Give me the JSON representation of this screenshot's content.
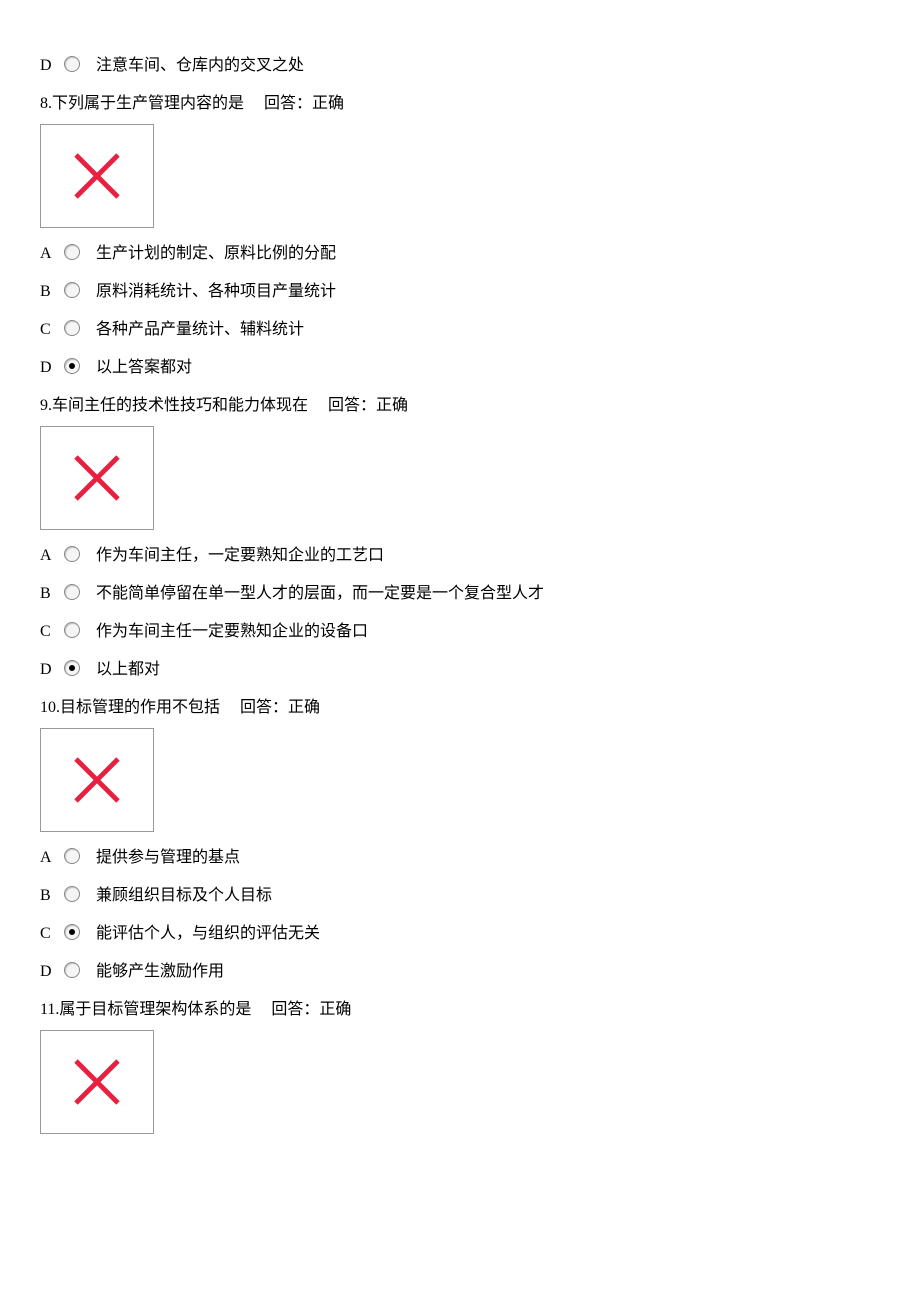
{
  "questions": [
    {
      "pre_options": [
        {
          "letter": "D",
          "text": "注意车间、仓库内的交叉之处",
          "selected": false
        }
      ],
      "number": "8",
      "text": "下列属于生产管理内容的是",
      "result_label": "回答：正确",
      "has_image": true,
      "options": [
        {
          "letter": "A",
          "text": "生产计划的制定、原料比例的分配",
          "selected": false
        },
        {
          "letter": "B",
          "text": "原料消耗统计、各种项目产量统计",
          "selected": false
        },
        {
          "letter": "C",
          "text": "各种产品产量统计、辅料统计",
          "selected": false
        },
        {
          "letter": "D",
          "text": "以上答案都对",
          "selected": true
        }
      ]
    },
    {
      "number": "9",
      "text": "车间主任的技术性技巧和能力体现在",
      "result_label": "回答：正确",
      "has_image": true,
      "options": [
        {
          "letter": "A",
          "text": "作为车间主任，一定要熟知企业的工艺口",
          "selected": false
        },
        {
          "letter": "B",
          "text": "不能简单停留在单一型人才的层面，而一定要是一个复合型人才",
          "selected": false
        },
        {
          "letter": "C",
          "text": "作为车间主任一定要熟知企业的设备口",
          "selected": false
        },
        {
          "letter": "D",
          "text": "以上都对",
          "selected": true
        }
      ]
    },
    {
      "number": "10",
      "text": "目标管理的作用不包括",
      "result_label": "回答：正确",
      "has_image": true,
      "options": [
        {
          "letter": "A",
          "text": "提供参与管理的基点",
          "selected": false
        },
        {
          "letter": "B",
          "text": "兼顾组织目标及个人目标",
          "selected": false
        },
        {
          "letter": "C",
          "text": "能评估个人，与组织的评估无关",
          "selected": true
        },
        {
          "letter": "D",
          "text": "能够产生激励作用",
          "selected": false
        }
      ]
    },
    {
      "number": "11",
      "text": "属于目标管理架构体系的是",
      "result_label": "回答：正确",
      "has_image": true,
      "options": []
    }
  ]
}
